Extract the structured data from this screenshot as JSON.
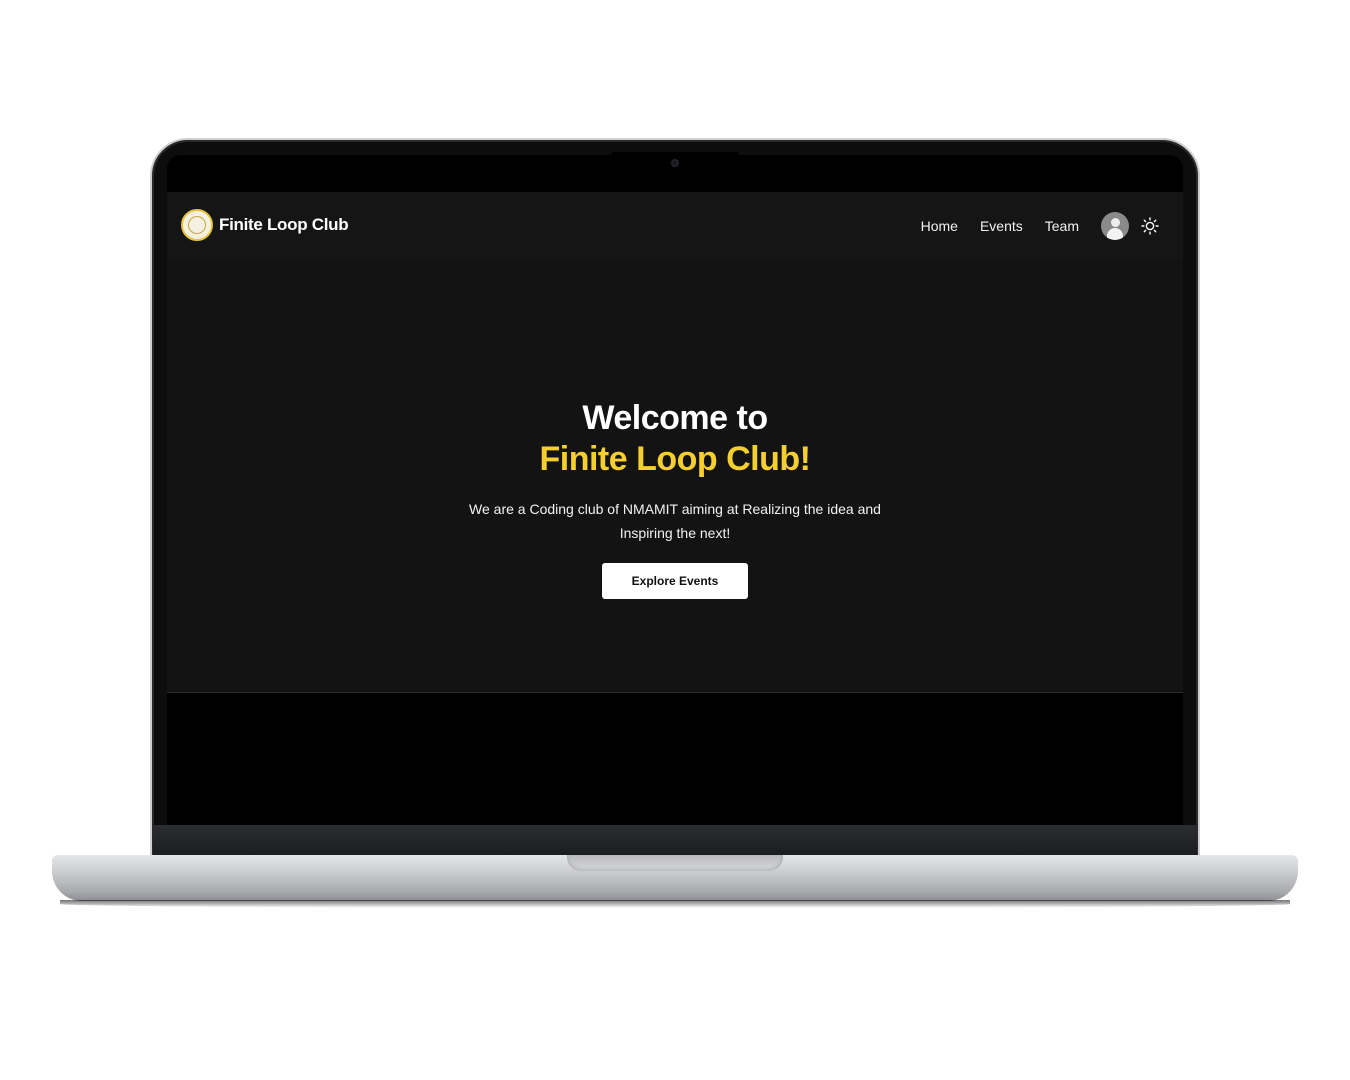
{
  "site": {
    "brand_name": "Finite Loop Club",
    "nav": {
      "home": "Home",
      "events": "Events",
      "team": "Team"
    },
    "hero": {
      "title_line1": "Welcome to",
      "title_line2": "Finite Loop Club!",
      "subtitle": "We are a Coding club of NMAMIT aiming at Realizing the idea and Inspiring the next!",
      "cta_label": "Explore Events"
    },
    "icons": {
      "logo": "club-logo-icon",
      "avatar": "user-avatar",
      "theme": "sun-icon"
    },
    "colors": {
      "accent": "#f5cf2f",
      "navbar_bg": "#151515",
      "hero_bg": "#131313",
      "button_bg": "#ffffff"
    }
  }
}
